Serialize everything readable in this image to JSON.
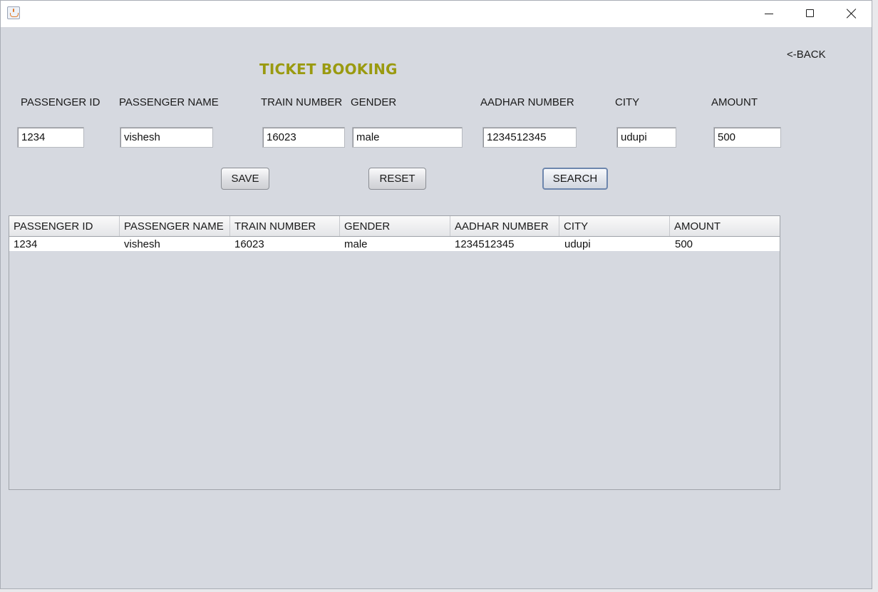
{
  "window": {
    "minimize_icon": "minimize-icon",
    "maximize_icon": "maximize-icon",
    "close_icon": "close-icon",
    "app_icon": "java-cup-icon"
  },
  "heading": "TICKET BOOKING",
  "back_label": "<-BACK",
  "form": {
    "labels": {
      "passenger_id": "PASSENGER ID",
      "passenger_name": "PASSENGER NAME",
      "train_number": "TRAIN NUMBER",
      "gender": "GENDER",
      "aadhar_number": "AADHAR NUMBER",
      "city": "CITY",
      "amount": "AMOUNT"
    },
    "values": {
      "passenger_id": "1234",
      "passenger_name": "vishesh",
      "train_number": "16023",
      "gender": "male",
      "aadhar_number": "1234512345",
      "city": "udupi",
      "amount": "500"
    }
  },
  "buttons": {
    "save": "SAVE",
    "reset": "RESET",
    "search": "SEARCH"
  },
  "table": {
    "headers": [
      "PASSENGER ID",
      "PASSENGER NAME",
      "TRAIN NUMBER",
      "GENDER",
      "AADHAR NUMBER",
      "CITY",
      "AMOUNT"
    ],
    "rows": [
      [
        "1234",
        "vishesh",
        "16023",
        "male",
        "1234512345",
        "udupi",
        "500"
      ]
    ]
  },
  "colors": {
    "heading": "#9a9a10",
    "background": "#d6d9e0",
    "focus_border": "#6d86ad"
  }
}
